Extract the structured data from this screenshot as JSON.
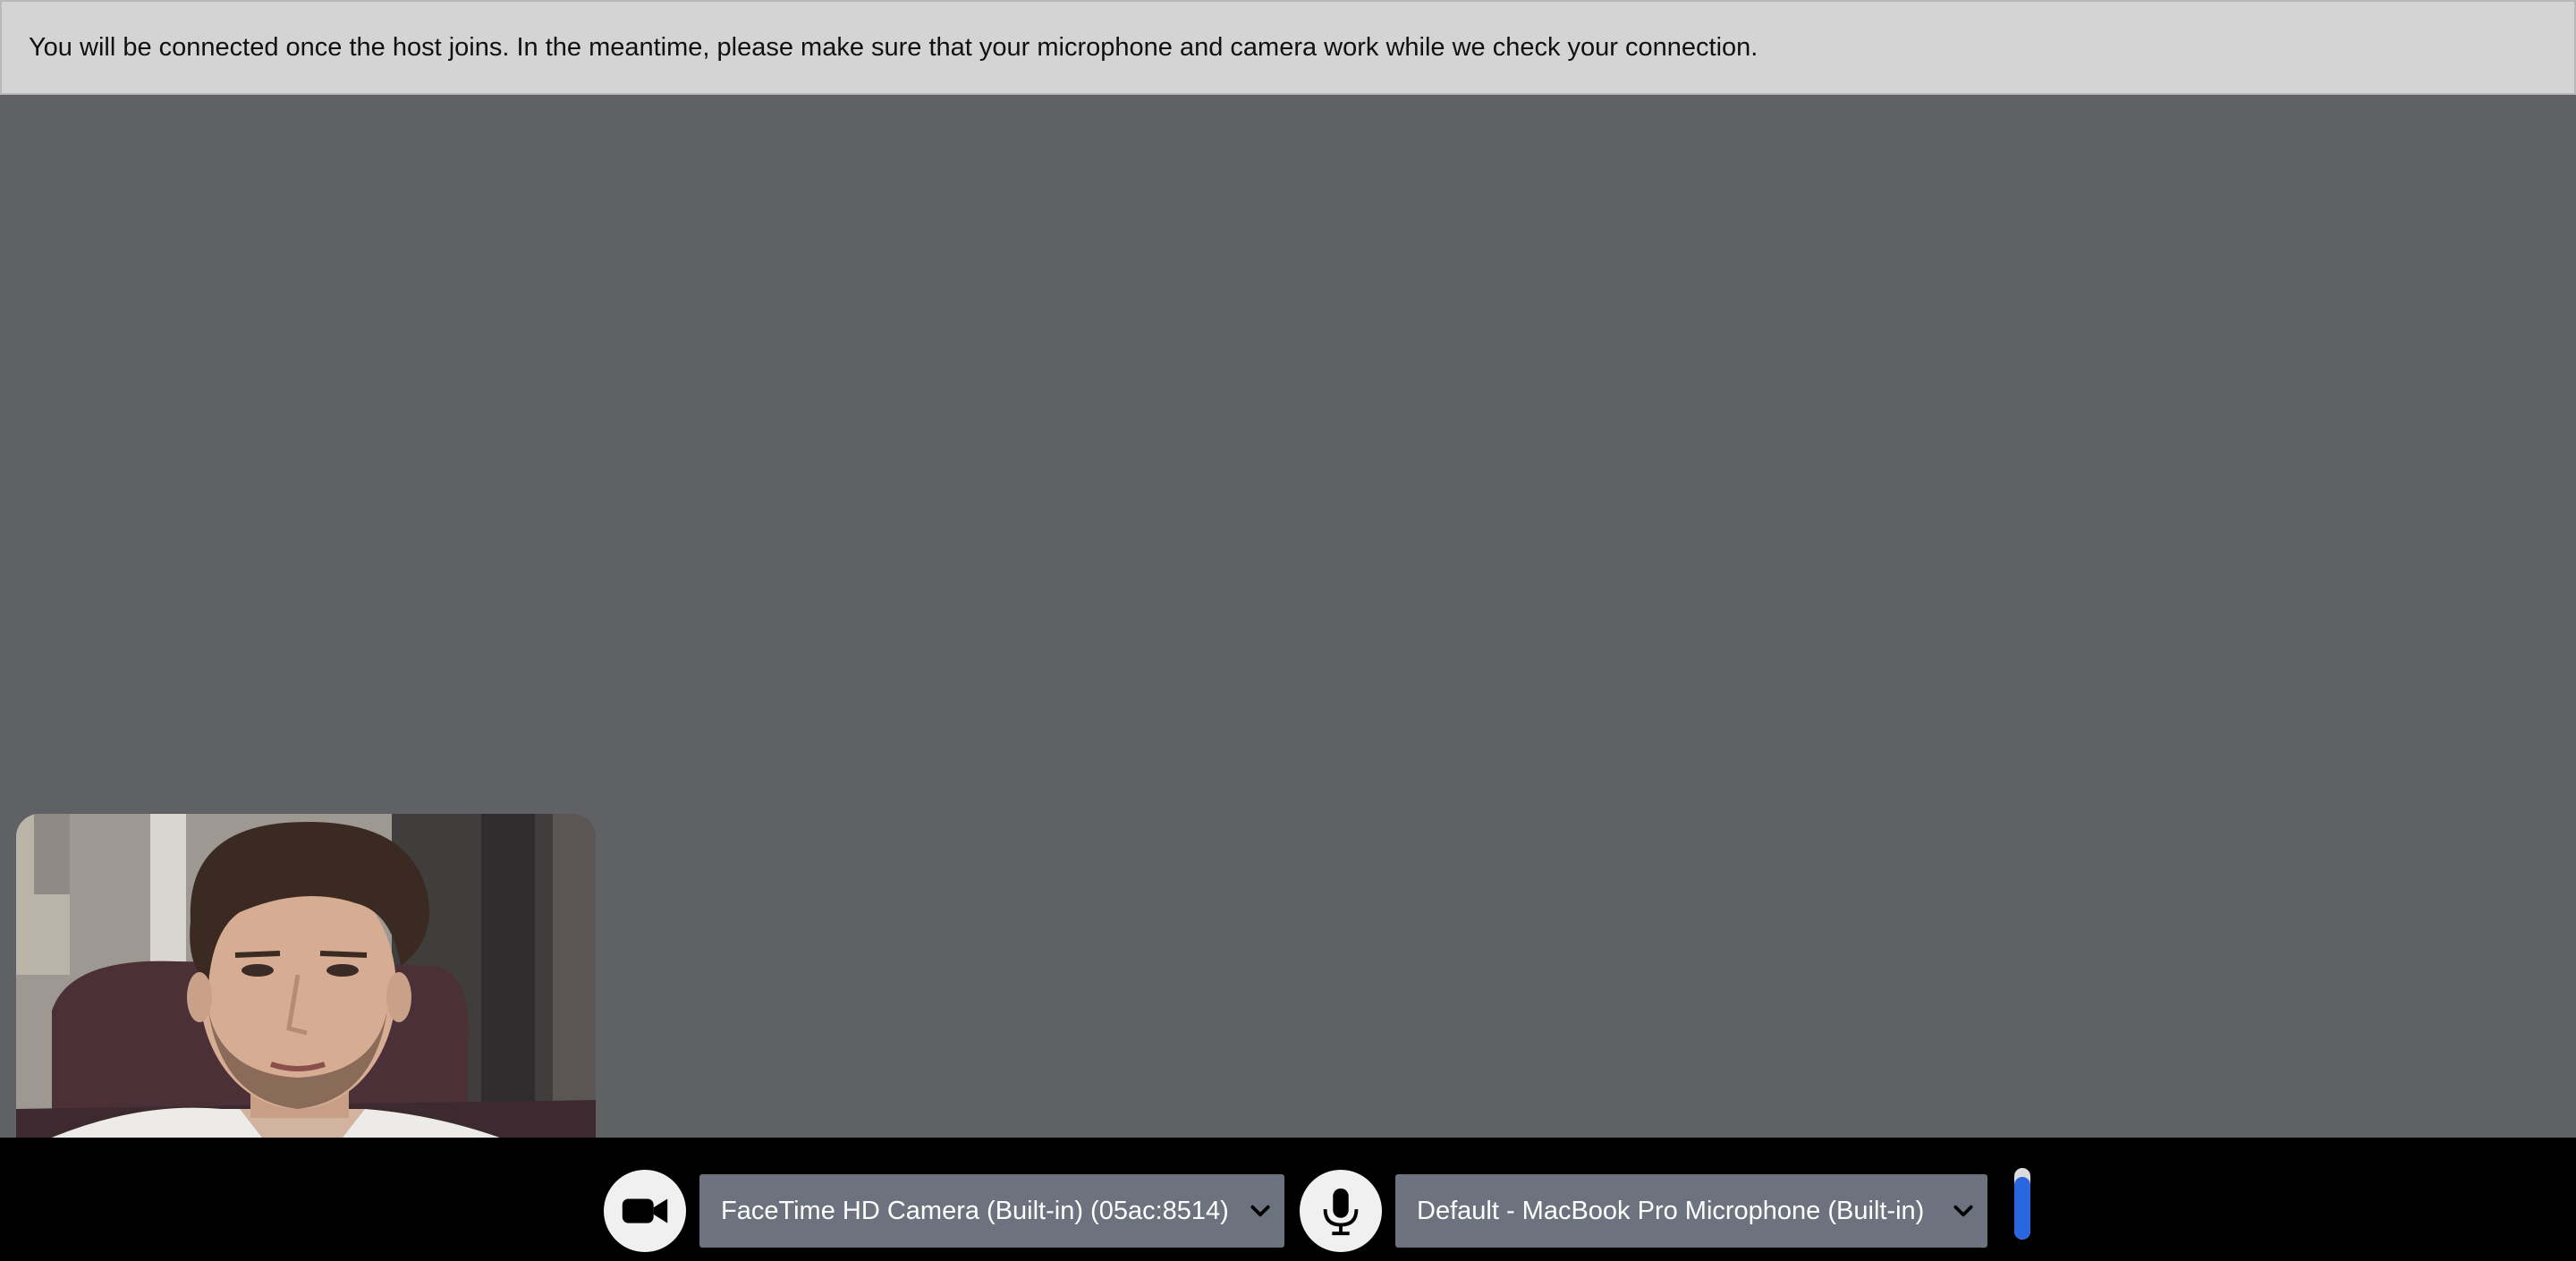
{
  "notice": {
    "text": "You will be connected once the host joins. In the meantime, please make sure that your microphone and camera work while we check your connection."
  },
  "self_view": {
    "description_icon": "webcam-preview"
  },
  "controls": {
    "camera_button_icon": "video-camera-icon",
    "camera_select_value": "FaceTime HD Camera (Built-in) (05ac:8514)",
    "mic_button_icon": "microphone-icon",
    "mic_select_value": "Default - MacBook Pro Microphone (Built-in)",
    "mic_level_fraction": 0.88
  },
  "colors": {
    "notice_bg": "#d4d4d4",
    "stage_bg": "#606164",
    "control_bar_bg": "#000000",
    "select_bg": "#6c737e",
    "level_accent": "#2a66e0"
  }
}
